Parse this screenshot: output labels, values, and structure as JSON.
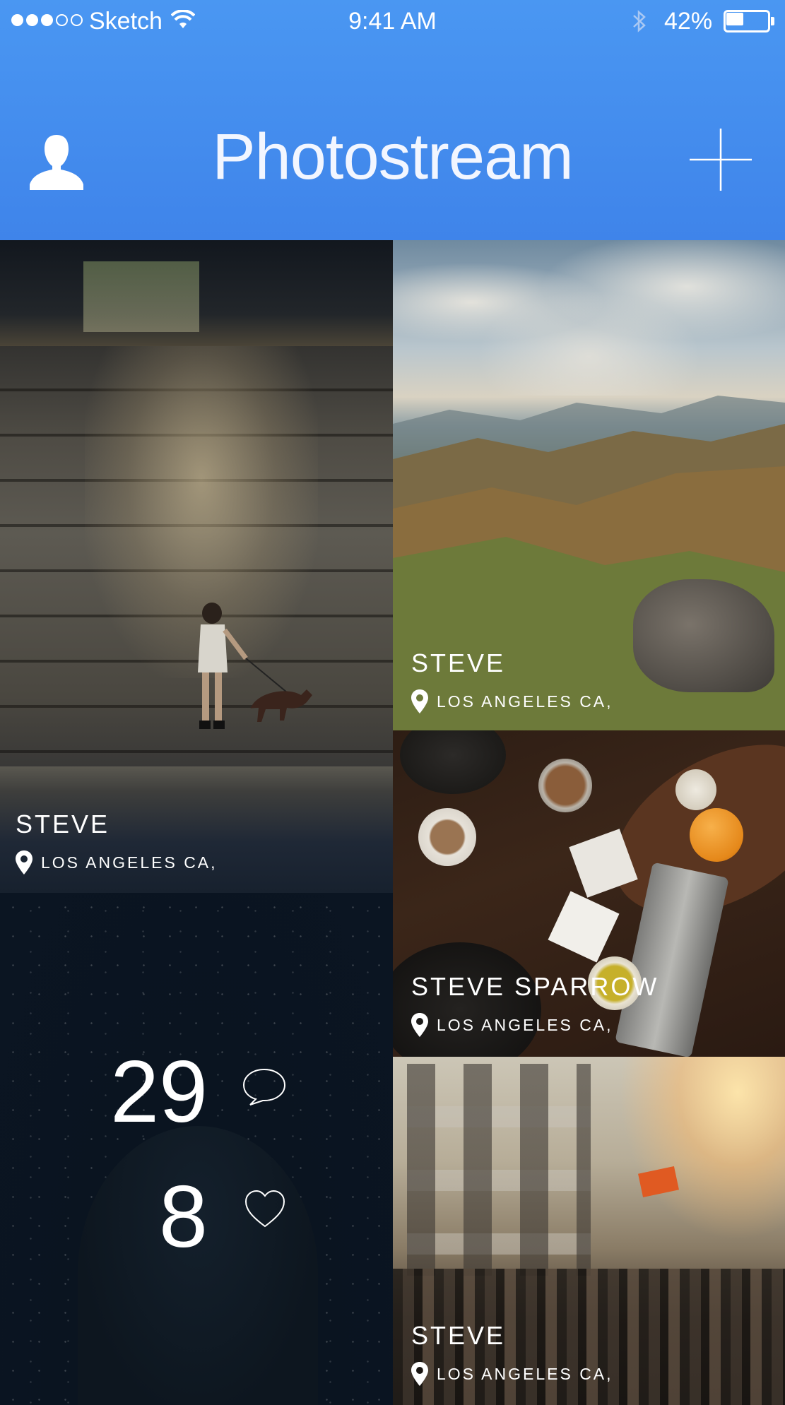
{
  "status_bar": {
    "carrier": "Sketch",
    "time": "9:41 AM",
    "battery_percent_label": "42%",
    "battery_level": 0.42,
    "signal_bars": 3,
    "signal_total": 5
  },
  "header": {
    "title": "Photostream",
    "left_icon": "profile-icon",
    "right_icon": "add-icon",
    "background_color": "#4a97f2"
  },
  "tiles": [
    {
      "name": "STEVE",
      "location": "LOS ANGELES CA,"
    },
    {
      "name": "STEVE",
      "location": "LOS ANGELES CA,"
    },
    {
      "name": "STEVE SPARROW",
      "location": "LOS ANGELES CA,"
    },
    {
      "name": "STEVE",
      "location": "LOS ANGELES CA,"
    }
  ],
  "stats": {
    "comments": "29",
    "likes": "8",
    "comment_icon": "speech-bubble-icon",
    "like_icon": "heart-icon"
  }
}
